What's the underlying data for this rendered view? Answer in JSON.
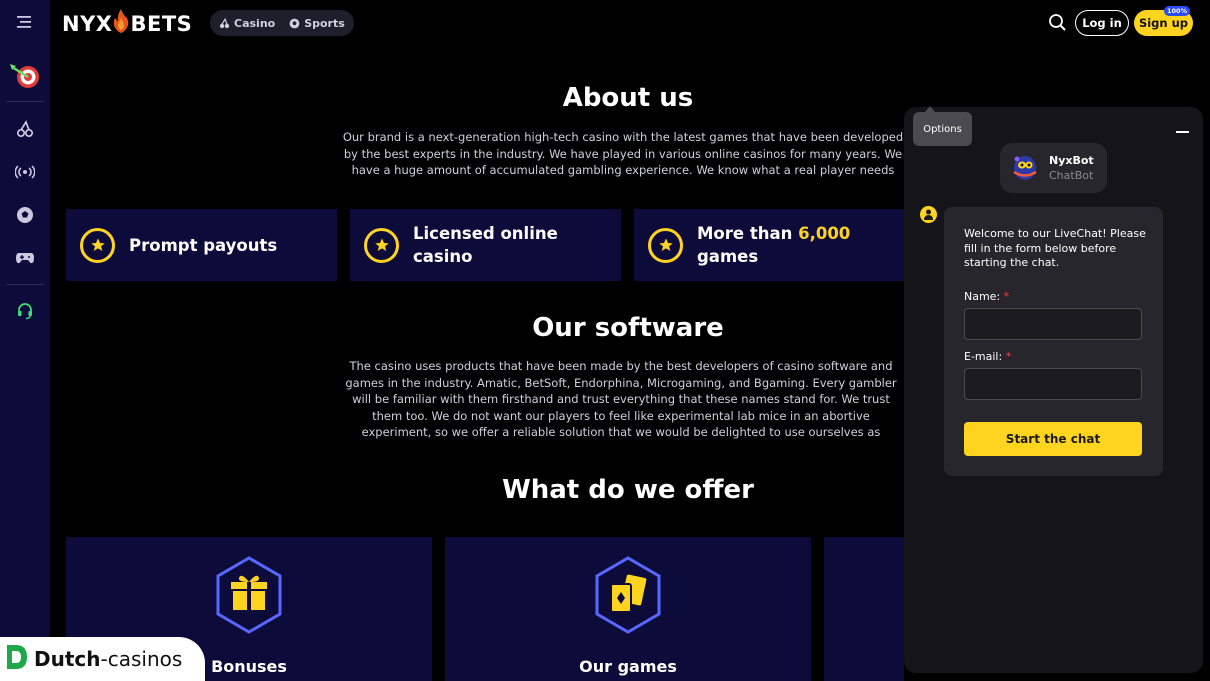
{
  "header": {
    "logo_left": "NYX",
    "logo_right": "BETS",
    "mode_casino": "Casino",
    "mode_sports": "Sports",
    "login_label": "Log in",
    "signup_label": "Sign up",
    "signup_badge": "100%"
  },
  "about": {
    "title": "About us",
    "text": "Our brand is a next-generation high-tech casino with the latest games that have been developed by the best experts in the industry. We have played in various online casinos for many years. We have a huge amount of accumulated gambling experience. We know what a real player needs"
  },
  "features": [
    {
      "text": "Prompt payouts",
      "highlight": "",
      "text2": ""
    },
    {
      "text": "Licensed online casino",
      "highlight": "",
      "text2": ""
    },
    {
      "text": "More than ",
      "highlight": "6,000",
      "text2": "games"
    }
  ],
  "software": {
    "title": "Our software",
    "text": "The casino uses products that have been made by the best developers of casino software and games in the industry. Amatic, BetSoft, Endorphina, Microgaming, and Bgaming. Every gambler will be familiar with them firsthand and trust everything that these names stand for. We trust them too. We do not want our players to feel like experimental lab mice in an abortive experiment, so we offer a reliable solution that we would be delighted to use ourselves as gamblers."
  },
  "offer": {
    "title": "What do we offer",
    "items": [
      {
        "label": "Bonuses"
      },
      {
        "label": "Our games"
      }
    ]
  },
  "chat": {
    "options_tooltip": "Options",
    "bot_name": "NyxBot",
    "bot_role": "ChatBot",
    "welcome": "Welcome to our LiveChat! Please fill in the form below before starting the chat.",
    "name_label": "Name:",
    "email_label": "E-mail:",
    "required_mark": "*",
    "name_value": "",
    "email_value": "",
    "start_label": "Start the chat"
  },
  "watermark": {
    "brand_bold": "Dutch",
    "brand_rest": "-casinos"
  },
  "colors": {
    "accent": "#ffd41f",
    "panel": "#0d0b3a",
    "background": "#000000",
    "chat_bg": "#151519"
  }
}
